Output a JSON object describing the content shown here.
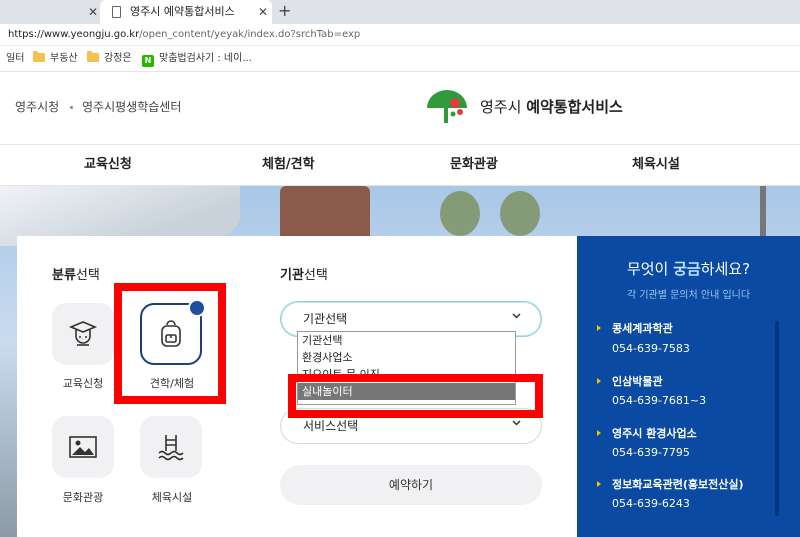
{
  "browser": {
    "active_tab_title": "영주시 예약통합서비스",
    "new_tab_symbol": "+",
    "close_symbol": "✕",
    "url_domain": "https://www.yeongju.go.kr",
    "url_path": "/open_content/yeyak/index.do?srchTab=exp",
    "bookmarks": [
      "일터",
      "부동산",
      "강정은",
      "맞춤법검사기 : 네이..."
    ]
  },
  "header": {
    "util_links": [
      "영주시청",
      "영주시평생학습센터"
    ],
    "logo_city": "영주시",
    "logo_service": "예약통합서비스"
  },
  "nav": {
    "items": [
      "교육신청",
      "체험/견학",
      "문화관광",
      "체육시설"
    ]
  },
  "category": {
    "title_bold": "분류",
    "title_rest": "선택",
    "items": [
      {
        "label": "교육신청",
        "icon": "graduate-icon",
        "selected": false
      },
      {
        "label": "견학/체험",
        "icon": "backpack-icon",
        "selected": true
      },
      {
        "label": "문화관광",
        "icon": "landscape-icon",
        "selected": false
      },
      {
        "label": "체육시설",
        "icon": "swimming-pool-icon",
        "selected": false
      }
    ]
  },
  "institution": {
    "title_bold": "기관",
    "title_rest": "선택",
    "select_label": "기관선택",
    "options": [
      "기관선택",
      "환경사업소",
      "지오이트 문 이진",
      "실내놀이터"
    ],
    "highlighted_option": "실내놀이터",
    "service_select_label": "서비스선택",
    "reserve_button": "예약하기"
  },
  "side": {
    "title_pre": "무엇이 ",
    "title_highlight": "궁금",
    "title_post": "하세요?",
    "subtitle": "각 기관별 문의처 안내 입니다",
    "contacts": [
      {
        "name": "콩세계과학관",
        "phone": "054-639-7583"
      },
      {
        "name": "인삼박물관",
        "phone": "054-639-7681~3"
      },
      {
        "name": "영주시 환경사업소",
        "phone": "054-639-7795"
      },
      {
        "name": "정보화교육관련(홍보전산실)",
        "phone": "054-639-6243"
      }
    ]
  },
  "colors": {
    "annotation_red": "#ff0000",
    "panel_blue": "#0a4aa2",
    "selected_border": "#1f3f7a",
    "bullet_yellow": "#f5c400"
  }
}
